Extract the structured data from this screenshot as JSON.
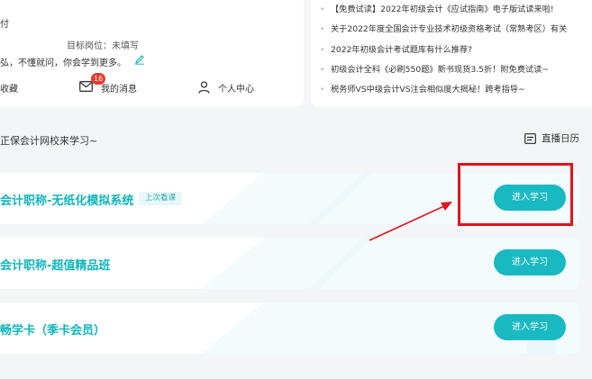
{
  "profile": {
    "line1": "付",
    "position": "目标岗位：未填写",
    "slogan": "弘，不懂就问，你会学到更多。"
  },
  "quick_actions": {
    "favorites_label": "收藏",
    "messages_label": "我的消息",
    "messages_badge": "16",
    "personal_center_label": "个人中心"
  },
  "news": [
    "【免费试读】2022年初级会计《应试指南》电子版试读来啦!",
    "关于2022年度全国会计专业技术初级资格考试（常熟考区）有关",
    "2022年初级会计考试题库有什么推荐?",
    "初级会计全科《必刷550题》新书现货3.5折！附免费试读~",
    "税务师VS中级会计VS注会相似度大揭秘！跨考指导~"
  ],
  "section": {
    "title": "正保会计网校来学习~",
    "live_calendar_label": "直播日历"
  },
  "courses": [
    {
      "name": "会计职称-无纸化模拟系统",
      "tag": "上次看课",
      "button": "进入学习"
    },
    {
      "name": "会计职称-超值精品班",
      "button": "进入学习"
    },
    {
      "name": "畅学卡（季卡会员）",
      "button": "进入学习"
    }
  ],
  "colors": {
    "accent": "#18b9c1",
    "course_title": "#0fb5bd",
    "badge": "#e93a30",
    "annotation_red": "#e0141e"
  }
}
